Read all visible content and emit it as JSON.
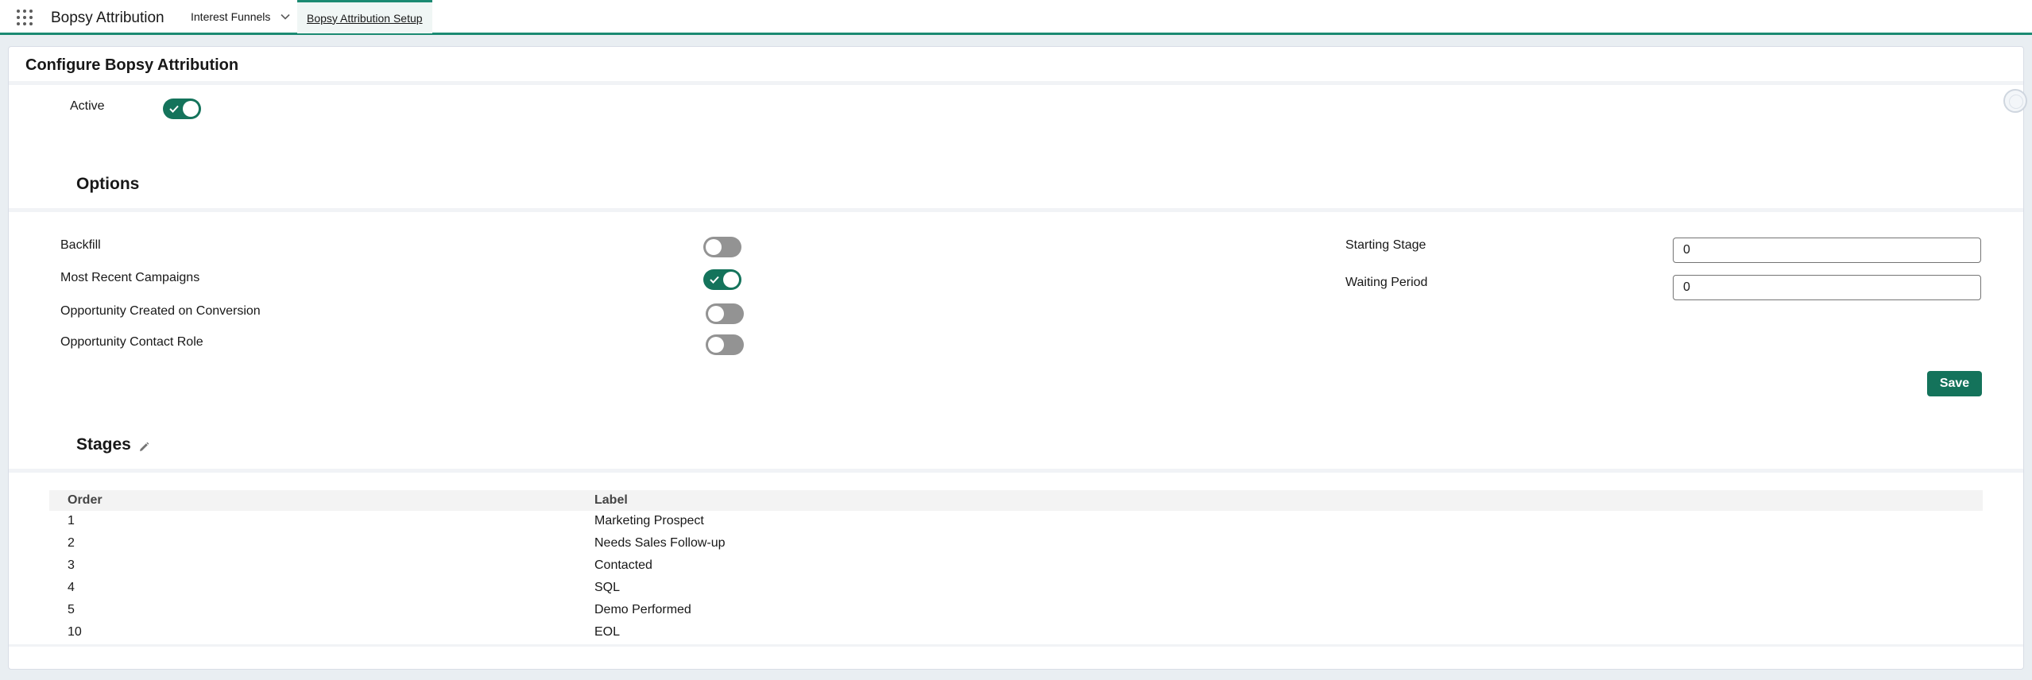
{
  "app": {
    "name": "Bopsy Attribution"
  },
  "nav": {
    "tabs": [
      {
        "label": "Interest Funnels",
        "has_dropdown": true
      },
      {
        "label": "Bopsy Attribution Setup",
        "active": true
      }
    ]
  },
  "page": {
    "title": "Configure Bopsy Attribution",
    "active": {
      "label": "Active",
      "value": true
    }
  },
  "options": {
    "title": "Options",
    "toggles": [
      {
        "label": "Backfill",
        "value": false
      },
      {
        "label": "Most Recent Campaigns",
        "value": true
      },
      {
        "label": "Opportunity Created on Conversion",
        "value": false
      },
      {
        "label": "Opportunity Contact Role",
        "value": false
      }
    ],
    "starting_stage": {
      "label": "Starting Stage",
      "value": "0"
    },
    "waiting_period": {
      "label": "Waiting Period",
      "value": "0"
    },
    "save_label": "Save"
  },
  "stages": {
    "title": "Stages",
    "columns": [
      "Order",
      "Label"
    ],
    "rows": [
      {
        "order": "1",
        "label": "Marketing Prospect"
      },
      {
        "order": "2",
        "label": "Needs Sales Follow-up"
      },
      {
        "order": "3",
        "label": "Contacted"
      },
      {
        "order": "4",
        "label": "SQL"
      },
      {
        "order": "5",
        "label": "Demo Performed"
      },
      {
        "order": "10",
        "label": "EOL"
      }
    ]
  },
  "colors": {
    "brand": "#14735b",
    "accent": "#1b8a72",
    "toggle_off": "#939393"
  },
  "icons": [
    "app-launcher-icon",
    "chevron-down-icon",
    "check-icon",
    "pencil-icon"
  ]
}
